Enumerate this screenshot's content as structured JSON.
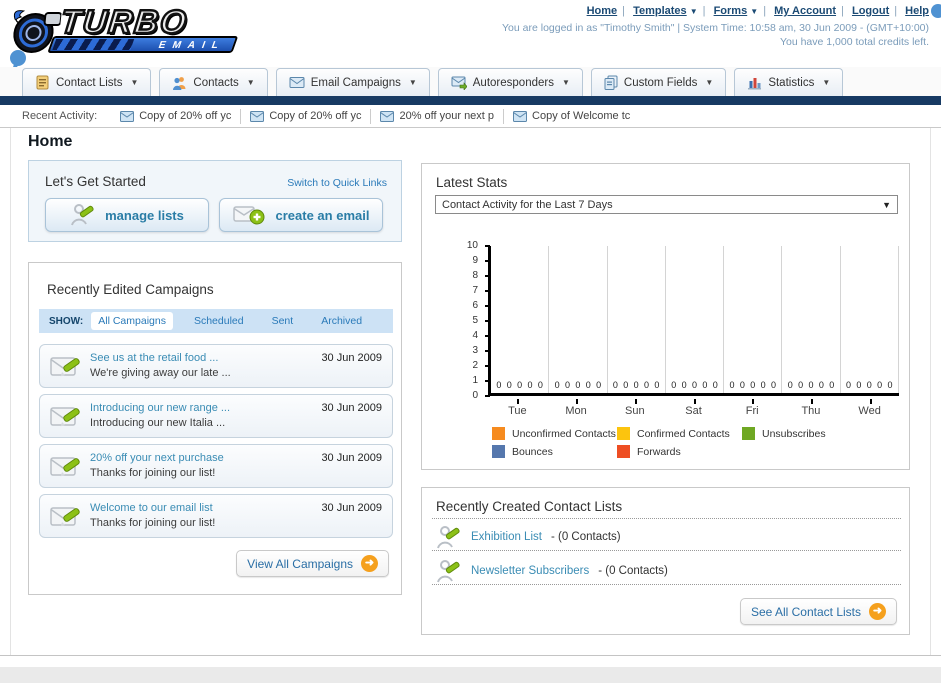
{
  "colors": {
    "navy_bar": "#173a63",
    "link_blue": "#2a76b5",
    "item_link": "#3a8cb4",
    "accent_orange": "#f5a01d",
    "annotation_blue": "#4f92d2"
  },
  "header": {
    "logo": {
      "line1": "TURBO",
      "line2": "EMAIL"
    },
    "nav_links": [
      {
        "label": "Home",
        "dropdown": false
      },
      {
        "label": "Templates",
        "dropdown": true
      },
      {
        "label": "Forms",
        "dropdown": true
      },
      {
        "label": "My Account",
        "dropdown": false
      },
      {
        "label": "Logout",
        "dropdown": false
      },
      {
        "label": "Help",
        "dropdown": false
      }
    ],
    "login_info": "You are logged in as \"Timothy Smith\" | System Time: 10:58 am, 30 Jun 2009 - (GMT+10:00)",
    "credits_info": "You have 1,000 total credits left."
  },
  "nav_tabs": [
    {
      "label": "Contact Lists",
      "icon": "contact-lists-icon"
    },
    {
      "label": "Contacts",
      "icon": "contacts-icon"
    },
    {
      "label": "Email Campaigns",
      "icon": "email-campaigns-icon"
    },
    {
      "label": "Autoresponders",
      "icon": "autoresponders-icon"
    },
    {
      "label": "Custom Fields",
      "icon": "custom-fields-icon"
    },
    {
      "label": "Statistics",
      "icon": "statistics-icon"
    }
  ],
  "recent_activity": {
    "label": "Recent Activity:",
    "items": [
      "Copy of 20% off yc",
      "Copy of 20% off yc",
      "20% off your next p",
      "Copy of Welcome tc"
    ]
  },
  "page_title": "Home",
  "get_started": {
    "title": "Let's Get Started",
    "switch_link": "Switch to Quick Links",
    "manage_lists_label": "manage lists",
    "create_email_label": "create an email"
  },
  "campaigns": {
    "title": "Recently Edited Campaigns",
    "show_label": "SHOW:",
    "filters": [
      "All Campaigns",
      "Scheduled",
      "Sent",
      "Archived"
    ],
    "active_filter": "All Campaigns",
    "items": [
      {
        "title": "See us at the retail food ...",
        "subtitle": "We're giving away our late ...",
        "date": "30 Jun 2009"
      },
      {
        "title": "Introducing our new range ...",
        "subtitle": "Introducing our new Italia ...",
        "date": "30 Jun 2009"
      },
      {
        "title": "20% off your next purchase",
        "subtitle": "Thanks for joining our list!",
        "date": "30 Jun 2009"
      },
      {
        "title": "Welcome to our email list",
        "subtitle": "Thanks for joining our list!",
        "date": "30 Jun 2009"
      }
    ],
    "view_all_label": "View All Campaigns"
  },
  "stats": {
    "title": "Latest Stats",
    "dropdown_value": "Contact Activity for the Last 7 Days"
  },
  "chart_data": {
    "type": "bar",
    "title": "Contact Activity for the Last 7 Days",
    "categories": [
      "Tue",
      "Mon",
      "Sun",
      "Sat",
      "Fri",
      "Thu",
      "Wed"
    ],
    "series": [
      {
        "name": "Unconfirmed Contacts",
        "color": "#f68b1f",
        "values": [
          0,
          0,
          0,
          0,
          0,
          0,
          0
        ]
      },
      {
        "name": "Confirmed Contacts",
        "color": "#fcc40e",
        "values": [
          0,
          0,
          0,
          0,
          0,
          0,
          0
        ]
      },
      {
        "name": "Unsubscribes",
        "color": "#6fa823",
        "values": [
          0,
          0,
          0,
          0,
          0,
          0,
          0
        ]
      },
      {
        "name": "Bounces",
        "color": "#5577ad",
        "values": [
          0,
          0,
          0,
          0,
          0,
          0,
          0
        ]
      },
      {
        "name": "Forwards",
        "color": "#ee4e23",
        "values": [
          0,
          0,
          0,
          0,
          0,
          0,
          0
        ]
      }
    ],
    "ylim": [
      0,
      10
    ],
    "yticks": [
      0,
      1,
      2,
      3,
      4,
      5,
      6,
      7,
      8,
      9,
      10
    ],
    "value_label_char": "0",
    "grid": true,
    "legend_position": "bottom"
  },
  "contact_lists": {
    "title": "Recently Created Contact Lists",
    "items": [
      {
        "name": "Exhibition List",
        "detail": "- (0 Contacts)"
      },
      {
        "name": "Newsletter Subscribers",
        "detail": "- (0 Contacts)"
      }
    ],
    "see_all_label": "See All Contact Lists"
  }
}
